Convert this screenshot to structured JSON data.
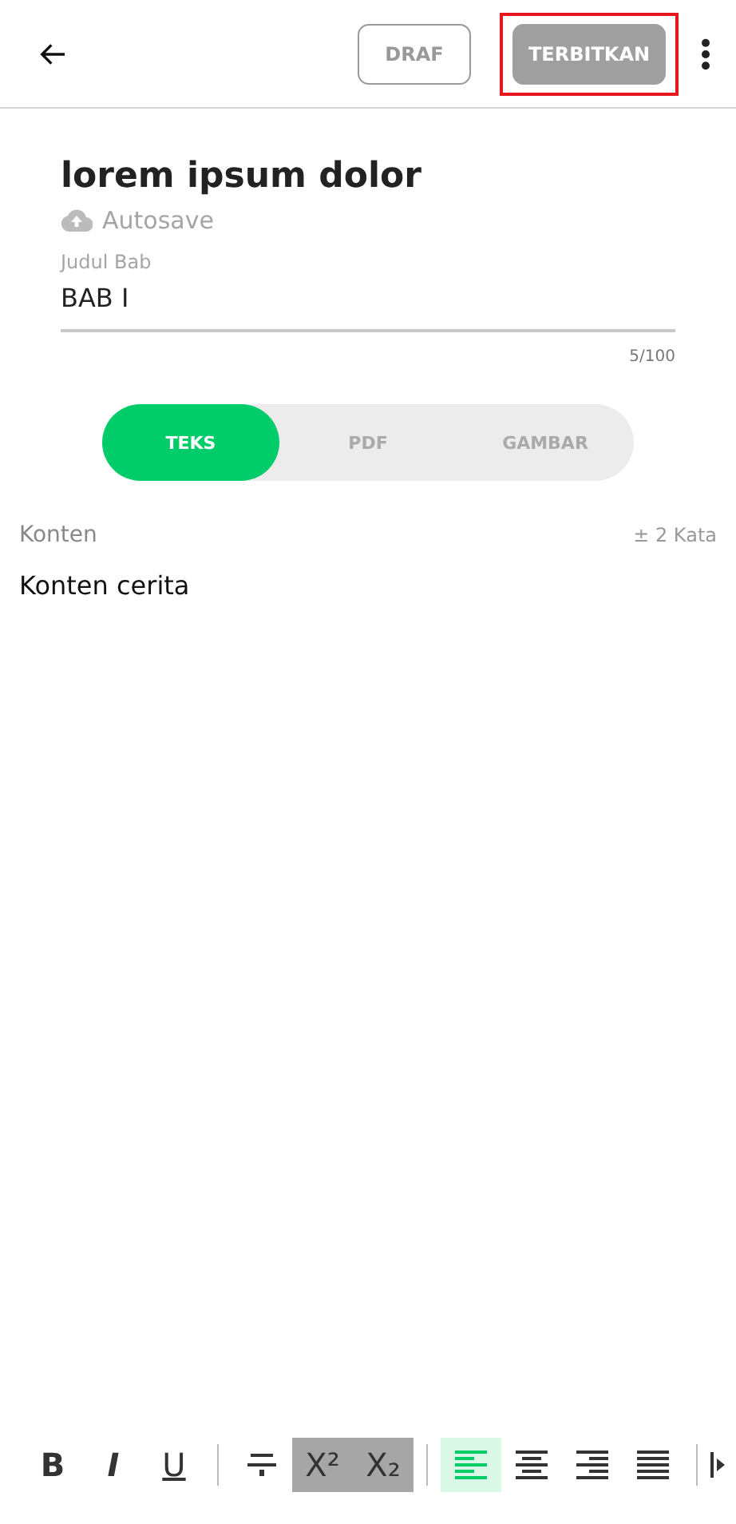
{
  "header": {
    "buttons": [
      {
        "label": "DRAF",
        "kind": "outline",
        "highlighted": false
      },
      {
        "label": "TERBITKAN",
        "kind": "filled",
        "highlighted": true
      }
    ]
  },
  "story": {
    "title": "lorem ipsum dolor",
    "autosave": "Autosave"
  },
  "chapter_field": {
    "label": "Judul Bab",
    "value": "BAB I",
    "counter": "5/100"
  },
  "tabs": [
    {
      "label": "TEKS",
      "selected": true
    },
    {
      "label": "PDF",
      "selected": false
    },
    {
      "label": "GAMBAR",
      "selected": false
    }
  ],
  "content": {
    "label": "Konten",
    "word_count": "± 2 Kata",
    "text": "Konten cerita"
  },
  "toolbar": [
    {
      "kind": "bold",
      "label": "B",
      "selected": false,
      "pressed": false
    },
    {
      "kind": "italic",
      "label": "I",
      "selected": false,
      "pressed": false
    },
    {
      "kind": "underline",
      "label": "U",
      "selected": false,
      "pressed": false
    },
    {
      "kind": "divider"
    },
    {
      "kind": "strike",
      "selected": false,
      "pressed": false
    },
    {
      "kind": "superscript",
      "label": "X²",
      "selected": false,
      "pressed": true
    },
    {
      "kind": "subscript",
      "label": "X₂",
      "selected": false,
      "pressed": true
    },
    {
      "kind": "divider"
    },
    {
      "kind": "align-left",
      "selected": true,
      "pressed": false
    },
    {
      "kind": "align-center",
      "selected": false,
      "pressed": false
    },
    {
      "kind": "align-right",
      "selected": false,
      "pressed": false
    },
    {
      "kind": "align-justify",
      "selected": false,
      "pressed": false
    },
    {
      "kind": "divider"
    },
    {
      "kind": "more",
      "selected": false,
      "pressed": false
    }
  ]
}
